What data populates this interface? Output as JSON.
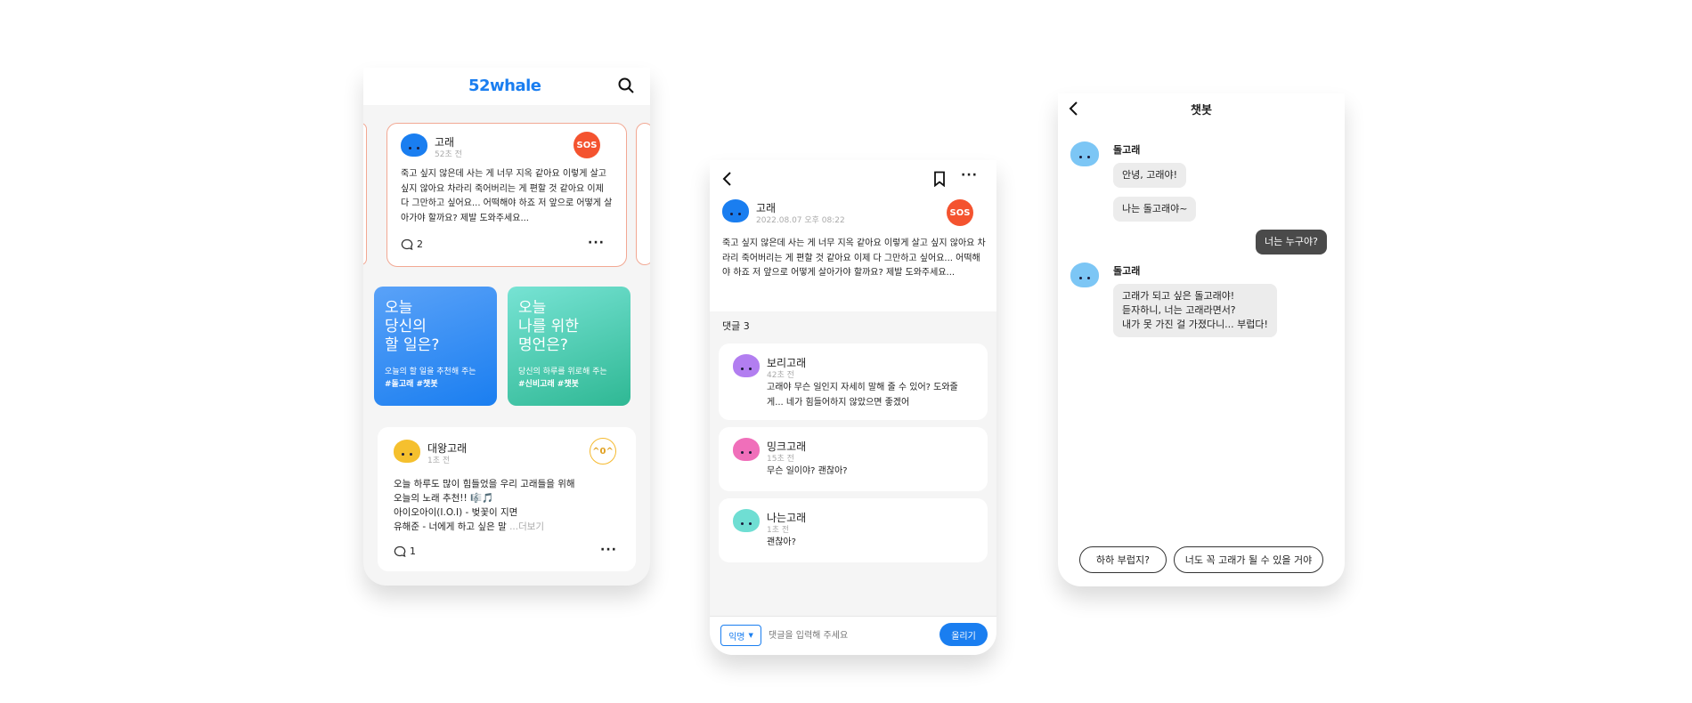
{
  "feed": {
    "logo": "52whale",
    "sos_card": {
      "author": "고래",
      "time": "52초 전",
      "badge": "SOS",
      "text": "죽고 싶지 않은데 사는 게 너무 지옥 같아요 이렇게 살고 싶지 않아요 차라리 죽어버리는 게 편할 것 같아요 이제 다 그만하고 싶어요... 어떡해야 하죠 저 앞으로 어떻게 살아가야 할까요? 제발 도와주세요...",
      "comment_count": "2"
    },
    "promo_left": {
      "title_line1": "오늘",
      "title_line2": "당신의",
      "title_line3": "할 일은?",
      "subtitle": "오늘의 할 일을 추천해 주는",
      "tags": "#돌고래 #챗봇"
    },
    "promo_right": {
      "title_line1": "오늘",
      "title_line2": "나를 위한",
      "title_line3": "명언은?",
      "subtitle": "당신의 하루를 위로해 주는",
      "tags": "#신비고래 #챗봇"
    },
    "post": {
      "author": "대왕고래",
      "time": "1초 전",
      "badge": "^0^",
      "line1": "오늘 하루도 많이 힘들었을 우리 고래들을 위해",
      "line2": "오늘의 노래 추천!! 🎼🎵",
      "line3": "아이오아이(I.O.I) - 벚꽃이 지면",
      "line4": "유해준 - 너에게 하고 싶은 말",
      "more": "...더보기",
      "comment_count": "1"
    }
  },
  "detail": {
    "author": "고래",
    "datetime": "2022.08.07 오후 08:22",
    "badge": "SOS",
    "text": "죽고 싶지 않은데 사는 게 너무 지옥 같아요 이렇게 살고 싶지 않아요 차라리 죽어버리는 게 편할 것 같아요 이제 다 그만하고 싶어요... 어떡해야 하죠 저 앞으로 어떻게 살아가야 할까요? 제발 도와주세요...",
    "comments_header": "댓글 3",
    "comments": [
      {
        "author": "보리고래",
        "time": "42초 전",
        "text": "고래야 무슨 일인지 자세히 말해 줄 수 있어? 도와줄게... 네가 힘들어하지 않았으면 좋겠어"
      },
      {
        "author": "밍크고래",
        "time": "15초 전",
        "text": "무슨 일이야? 괜찮아?"
      },
      {
        "author": "나는고래",
        "time": "1초 전",
        "text": "괜찮아?"
      }
    ],
    "anon_label": "익명",
    "input_placeholder": "댓글을 입력해 주세요",
    "submit_label": "올리기"
  },
  "chat": {
    "title": "챗봇",
    "bot_name": "돌고래",
    "msg1": "안녕, 고래야!",
    "msg2": "나는 돌고래야~",
    "user_msg": "너는 누구야?",
    "msg3_line1": "고래가 되고 싶은 돌고래야!",
    "msg3_line2": "듣자하니, 너는 고래라면서?",
    "msg3_line3": "내가 못 가진 걸 가졌다니... 부럽다!",
    "chip1": "하하 부럽지?",
    "chip2": "너도 꼭 고래가 될 수 있을 거야"
  },
  "colors": {
    "accent": "#1a7ef0",
    "sos": "#f4532f",
    "promo_blue": "#3c8ff5",
    "promo_green": "#3cc4a5",
    "gold": "#f5b92e"
  }
}
